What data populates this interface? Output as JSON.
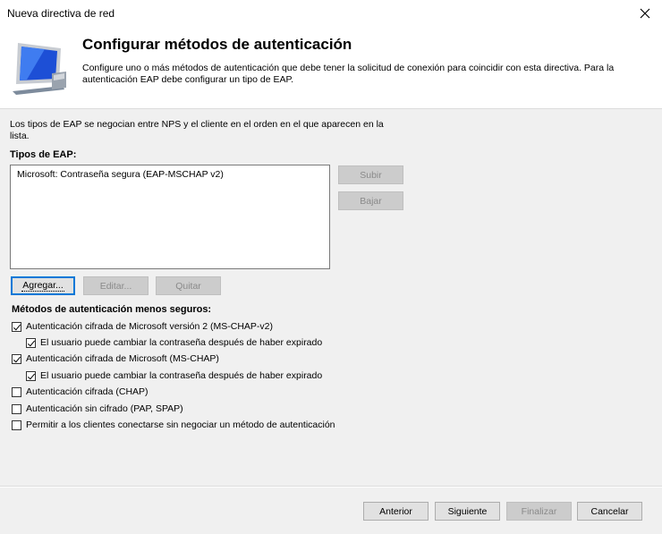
{
  "window": {
    "title": "Nueva directiva de red",
    "close_icon": "close-icon"
  },
  "header": {
    "heading": "Configurar métodos de autenticación",
    "description": "Configure uno o más métodos de autenticación que debe tener la solicitud de conexión para coincidir con esta directiva. Para la autenticación EAP debe configurar un tipo de EAP.",
    "icon": "computer-monitor-icon"
  },
  "eap": {
    "intro": "Los tipos de EAP se negocian entre NPS y el cliente en el orden en el que aparecen en la lista.",
    "label": "Tipos de EAP:",
    "items": [
      "Microsoft: Contraseña segura (EAP-MSCHAP v2)"
    ],
    "buttons": {
      "up": "Subir",
      "down": "Bajar",
      "add": "Agregar...",
      "edit": "Editar...",
      "remove": "Quitar"
    }
  },
  "less_secure": {
    "label": "Métodos de autenticación menos seguros:",
    "options": [
      {
        "label": "Autenticación cifrada de Microsoft versión 2 (MS-CHAP-v2)",
        "checked": true
      },
      {
        "label": "El usuario puede cambiar la contraseña después de haber expirado",
        "checked": true
      },
      {
        "label": "Autenticación cifrada de Microsoft (MS-CHAP)",
        "checked": true
      },
      {
        "label": "El usuario puede cambiar la contraseña después de haber expirado",
        "checked": true
      },
      {
        "label": "Autenticación cifrada (CHAP)",
        "checked": false
      },
      {
        "label": "Autenticación sin cifrado (PAP, SPAP)",
        "checked": false
      },
      {
        "label": "Permitir a los clientes conectarse sin negociar un método de autenticación",
        "checked": false
      }
    ]
  },
  "footer": {
    "back": "Anterior",
    "next": "Siguiente",
    "finish": "Finalizar",
    "cancel": "Cancelar"
  }
}
